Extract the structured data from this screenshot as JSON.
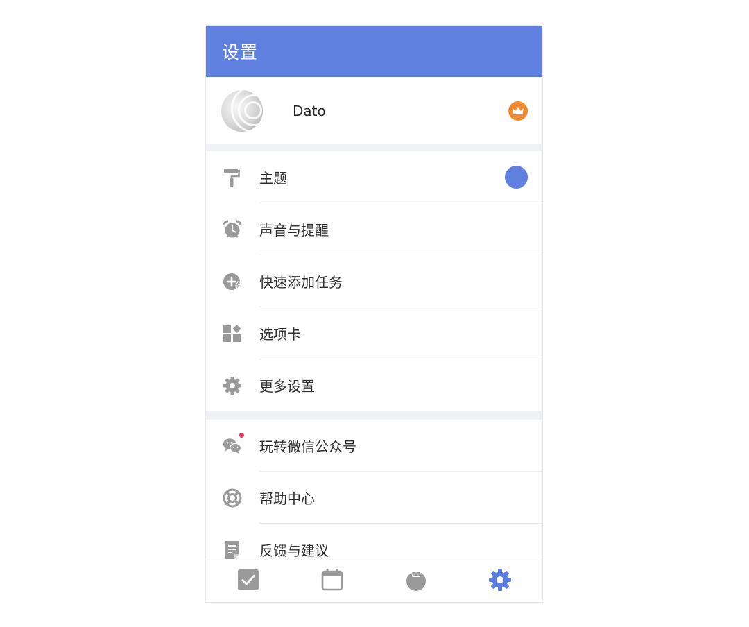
{
  "header": {
    "title": "设置"
  },
  "profile": {
    "name": "Dato",
    "avatar_icon": "avatar-image",
    "badge_icon": "crown-icon",
    "badge_color": "#f08a30"
  },
  "theme": {
    "accent_color": "#6080e0"
  },
  "menu_group_1": [
    {
      "label": "主题",
      "icon": "paint-roller-icon"
    },
    {
      "label": "声音与提醒",
      "icon": "alarm-clock-icon"
    },
    {
      "label": "快速添加任务",
      "icon": "quick-add-icon"
    },
    {
      "label": "选项卡",
      "icon": "widgets-icon"
    },
    {
      "label": "更多设置",
      "icon": "gear-icon"
    }
  ],
  "menu_group_2": [
    {
      "label": "玩转微信公众号",
      "icon": "wechat-icon"
    },
    {
      "label": "帮助中心",
      "icon": "lifebuoy-icon"
    },
    {
      "label": "反馈与建议",
      "icon": "feedback-note-icon"
    }
  ],
  "tabbar": [
    {
      "icon": "checkbox-icon",
      "active": false
    },
    {
      "icon": "calendar-icon",
      "active": false
    },
    {
      "icon": "tomato-timer-icon",
      "active": false
    },
    {
      "icon": "settings-gear-icon",
      "active": true
    }
  ],
  "colors": {
    "icon_gray": "#9a9a9a",
    "notification_red": "#e8365a"
  }
}
